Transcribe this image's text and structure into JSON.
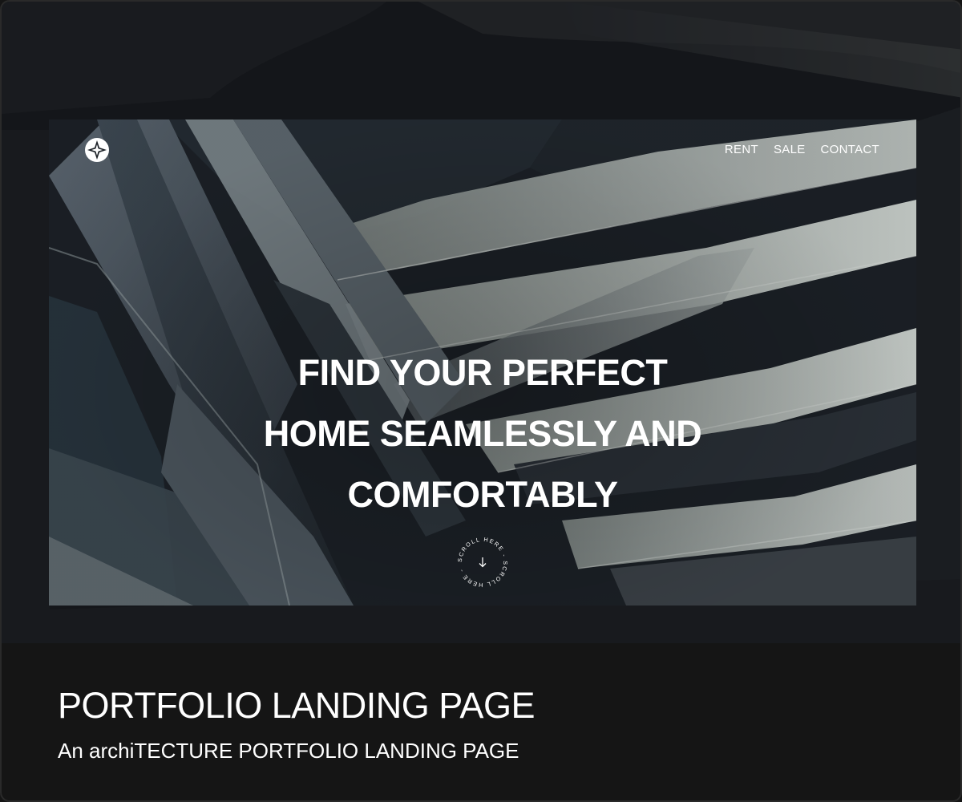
{
  "nav": {
    "items": [
      {
        "label": "RENT"
      },
      {
        "label": "SALE"
      },
      {
        "label": "CONTACT"
      }
    ]
  },
  "hero": {
    "lines": [
      "FIND YOUR PERFECT",
      "HOME SEAMLESSLY AND",
      "COMFORTABLY"
    ]
  },
  "scroll": {
    "label": "SCROLL HERE - SCROLL HERE -",
    "icon": "arrow-down-icon"
  },
  "logo": {
    "icon": "compass-star-logo"
  },
  "caption": {
    "title": "PORTFOLIO LANDING PAGE",
    "subtitle": "An archiTECTURE PORTFOLIO LANDING PAGE"
  },
  "colors": {
    "background": "#151515",
    "text": "#ffffff",
    "building_light": "#b9bfbd",
    "building_dark": "#1c2127"
  }
}
